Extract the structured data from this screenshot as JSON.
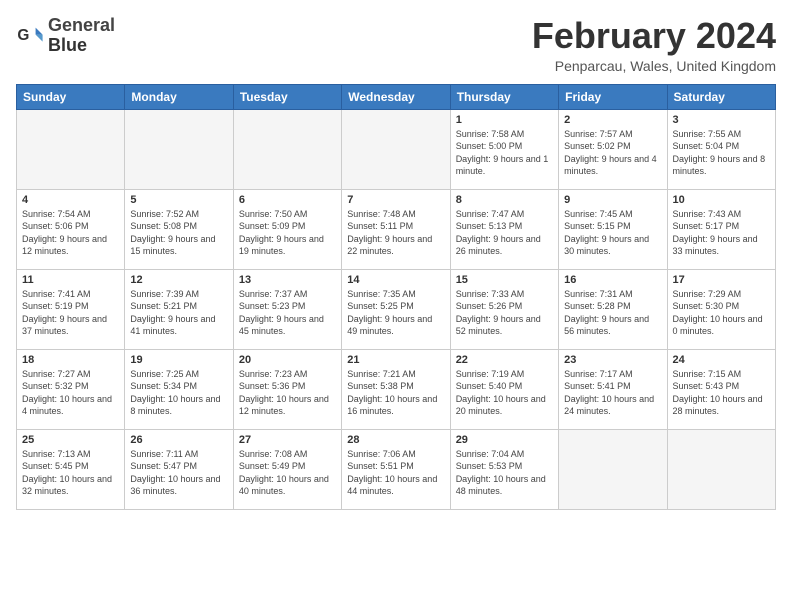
{
  "header": {
    "logo_line1": "General",
    "logo_line2": "Blue",
    "month_title": "February 2024",
    "location": "Penparcau, Wales, United Kingdom"
  },
  "weekdays": [
    "Sunday",
    "Monday",
    "Tuesday",
    "Wednesday",
    "Thursday",
    "Friday",
    "Saturday"
  ],
  "weeks": [
    [
      {
        "day": "",
        "sunrise": "",
        "sunset": "",
        "daylight": "",
        "empty": true
      },
      {
        "day": "",
        "sunrise": "",
        "sunset": "",
        "daylight": "",
        "empty": true
      },
      {
        "day": "",
        "sunrise": "",
        "sunset": "",
        "daylight": "",
        "empty": true
      },
      {
        "day": "",
        "sunrise": "",
        "sunset": "",
        "daylight": "",
        "empty": true
      },
      {
        "day": "1",
        "sunrise": "Sunrise: 7:58 AM",
        "sunset": "Sunset: 5:00 PM",
        "daylight": "Daylight: 9 hours and 1 minute.",
        "empty": false
      },
      {
        "day": "2",
        "sunrise": "Sunrise: 7:57 AM",
        "sunset": "Sunset: 5:02 PM",
        "daylight": "Daylight: 9 hours and 4 minutes.",
        "empty": false
      },
      {
        "day": "3",
        "sunrise": "Sunrise: 7:55 AM",
        "sunset": "Sunset: 5:04 PM",
        "daylight": "Daylight: 9 hours and 8 minutes.",
        "empty": false
      }
    ],
    [
      {
        "day": "4",
        "sunrise": "Sunrise: 7:54 AM",
        "sunset": "Sunset: 5:06 PM",
        "daylight": "Daylight: 9 hours and 12 minutes.",
        "empty": false
      },
      {
        "day": "5",
        "sunrise": "Sunrise: 7:52 AM",
        "sunset": "Sunset: 5:08 PM",
        "daylight": "Daylight: 9 hours and 15 minutes.",
        "empty": false
      },
      {
        "day": "6",
        "sunrise": "Sunrise: 7:50 AM",
        "sunset": "Sunset: 5:09 PM",
        "daylight": "Daylight: 9 hours and 19 minutes.",
        "empty": false
      },
      {
        "day": "7",
        "sunrise": "Sunrise: 7:48 AM",
        "sunset": "Sunset: 5:11 PM",
        "daylight": "Daylight: 9 hours and 22 minutes.",
        "empty": false
      },
      {
        "day": "8",
        "sunrise": "Sunrise: 7:47 AM",
        "sunset": "Sunset: 5:13 PM",
        "daylight": "Daylight: 9 hours and 26 minutes.",
        "empty": false
      },
      {
        "day": "9",
        "sunrise": "Sunrise: 7:45 AM",
        "sunset": "Sunset: 5:15 PM",
        "daylight": "Daylight: 9 hours and 30 minutes.",
        "empty": false
      },
      {
        "day": "10",
        "sunrise": "Sunrise: 7:43 AM",
        "sunset": "Sunset: 5:17 PM",
        "daylight": "Daylight: 9 hours and 33 minutes.",
        "empty": false
      }
    ],
    [
      {
        "day": "11",
        "sunrise": "Sunrise: 7:41 AM",
        "sunset": "Sunset: 5:19 PM",
        "daylight": "Daylight: 9 hours and 37 minutes.",
        "empty": false
      },
      {
        "day": "12",
        "sunrise": "Sunrise: 7:39 AM",
        "sunset": "Sunset: 5:21 PM",
        "daylight": "Daylight: 9 hours and 41 minutes.",
        "empty": false
      },
      {
        "day": "13",
        "sunrise": "Sunrise: 7:37 AM",
        "sunset": "Sunset: 5:23 PM",
        "daylight": "Daylight: 9 hours and 45 minutes.",
        "empty": false
      },
      {
        "day": "14",
        "sunrise": "Sunrise: 7:35 AM",
        "sunset": "Sunset: 5:25 PM",
        "daylight": "Daylight: 9 hours and 49 minutes.",
        "empty": false
      },
      {
        "day": "15",
        "sunrise": "Sunrise: 7:33 AM",
        "sunset": "Sunset: 5:26 PM",
        "daylight": "Daylight: 9 hours and 52 minutes.",
        "empty": false
      },
      {
        "day": "16",
        "sunrise": "Sunrise: 7:31 AM",
        "sunset": "Sunset: 5:28 PM",
        "daylight": "Daylight: 9 hours and 56 minutes.",
        "empty": false
      },
      {
        "day": "17",
        "sunrise": "Sunrise: 7:29 AM",
        "sunset": "Sunset: 5:30 PM",
        "daylight": "Daylight: 10 hours and 0 minutes.",
        "empty": false
      }
    ],
    [
      {
        "day": "18",
        "sunrise": "Sunrise: 7:27 AM",
        "sunset": "Sunset: 5:32 PM",
        "daylight": "Daylight: 10 hours and 4 minutes.",
        "empty": false
      },
      {
        "day": "19",
        "sunrise": "Sunrise: 7:25 AM",
        "sunset": "Sunset: 5:34 PM",
        "daylight": "Daylight: 10 hours and 8 minutes.",
        "empty": false
      },
      {
        "day": "20",
        "sunrise": "Sunrise: 7:23 AM",
        "sunset": "Sunset: 5:36 PM",
        "daylight": "Daylight: 10 hours and 12 minutes.",
        "empty": false
      },
      {
        "day": "21",
        "sunrise": "Sunrise: 7:21 AM",
        "sunset": "Sunset: 5:38 PM",
        "daylight": "Daylight: 10 hours and 16 minutes.",
        "empty": false
      },
      {
        "day": "22",
        "sunrise": "Sunrise: 7:19 AM",
        "sunset": "Sunset: 5:40 PM",
        "daylight": "Daylight: 10 hours and 20 minutes.",
        "empty": false
      },
      {
        "day": "23",
        "sunrise": "Sunrise: 7:17 AM",
        "sunset": "Sunset: 5:41 PM",
        "daylight": "Daylight: 10 hours and 24 minutes.",
        "empty": false
      },
      {
        "day": "24",
        "sunrise": "Sunrise: 7:15 AM",
        "sunset": "Sunset: 5:43 PM",
        "daylight": "Daylight: 10 hours and 28 minutes.",
        "empty": false
      }
    ],
    [
      {
        "day": "25",
        "sunrise": "Sunrise: 7:13 AM",
        "sunset": "Sunset: 5:45 PM",
        "daylight": "Daylight: 10 hours and 32 minutes.",
        "empty": false
      },
      {
        "day": "26",
        "sunrise": "Sunrise: 7:11 AM",
        "sunset": "Sunset: 5:47 PM",
        "daylight": "Daylight: 10 hours and 36 minutes.",
        "empty": false
      },
      {
        "day": "27",
        "sunrise": "Sunrise: 7:08 AM",
        "sunset": "Sunset: 5:49 PM",
        "daylight": "Daylight: 10 hours and 40 minutes.",
        "empty": false
      },
      {
        "day": "28",
        "sunrise": "Sunrise: 7:06 AM",
        "sunset": "Sunset: 5:51 PM",
        "daylight": "Daylight: 10 hours and 44 minutes.",
        "empty": false
      },
      {
        "day": "29",
        "sunrise": "Sunrise: 7:04 AM",
        "sunset": "Sunset: 5:53 PM",
        "daylight": "Daylight: 10 hours and 48 minutes.",
        "empty": false
      },
      {
        "day": "",
        "sunrise": "",
        "sunset": "",
        "daylight": "",
        "empty": true
      },
      {
        "day": "",
        "sunrise": "",
        "sunset": "",
        "daylight": "",
        "empty": true
      }
    ]
  ]
}
